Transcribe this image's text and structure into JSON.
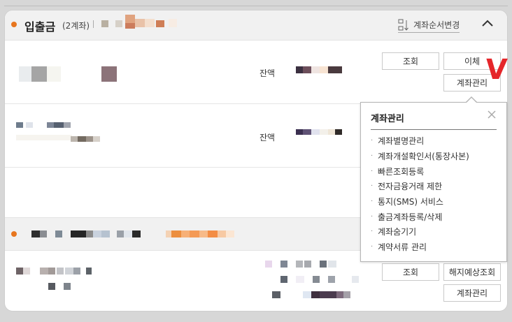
{
  "section1": {
    "title": "입출금",
    "count": "(2계좌)",
    "order_button": "계좌순서변경",
    "icons": {
      "order": "sort-list-icon",
      "collapse": "chevron-up-icon"
    }
  },
  "accounts": [
    {
      "balance_label": "잔액",
      "buttons": [
        "조회",
        "이체",
        "계좌관리"
      ]
    },
    {
      "balance_label": "잔액"
    }
  ],
  "section2": {
    "buttons": [
      "조회",
      "해지예상조회",
      "계좌관리"
    ]
  },
  "popup": {
    "title": "계좌관리",
    "items": [
      "계좌별명관리",
      "계좌개설확인서(통장사본)",
      "빠른조회등록",
      "전자금융거래 제한",
      "통지(SMS) 서비스",
      "출금계좌등록/삭제",
      "계좌숨기기",
      "계약서류 관리"
    ]
  },
  "annotations": {
    "mark": "V"
  },
  "colors": {
    "accent_dot": "#e7761f",
    "annotation": "#e5262a"
  }
}
